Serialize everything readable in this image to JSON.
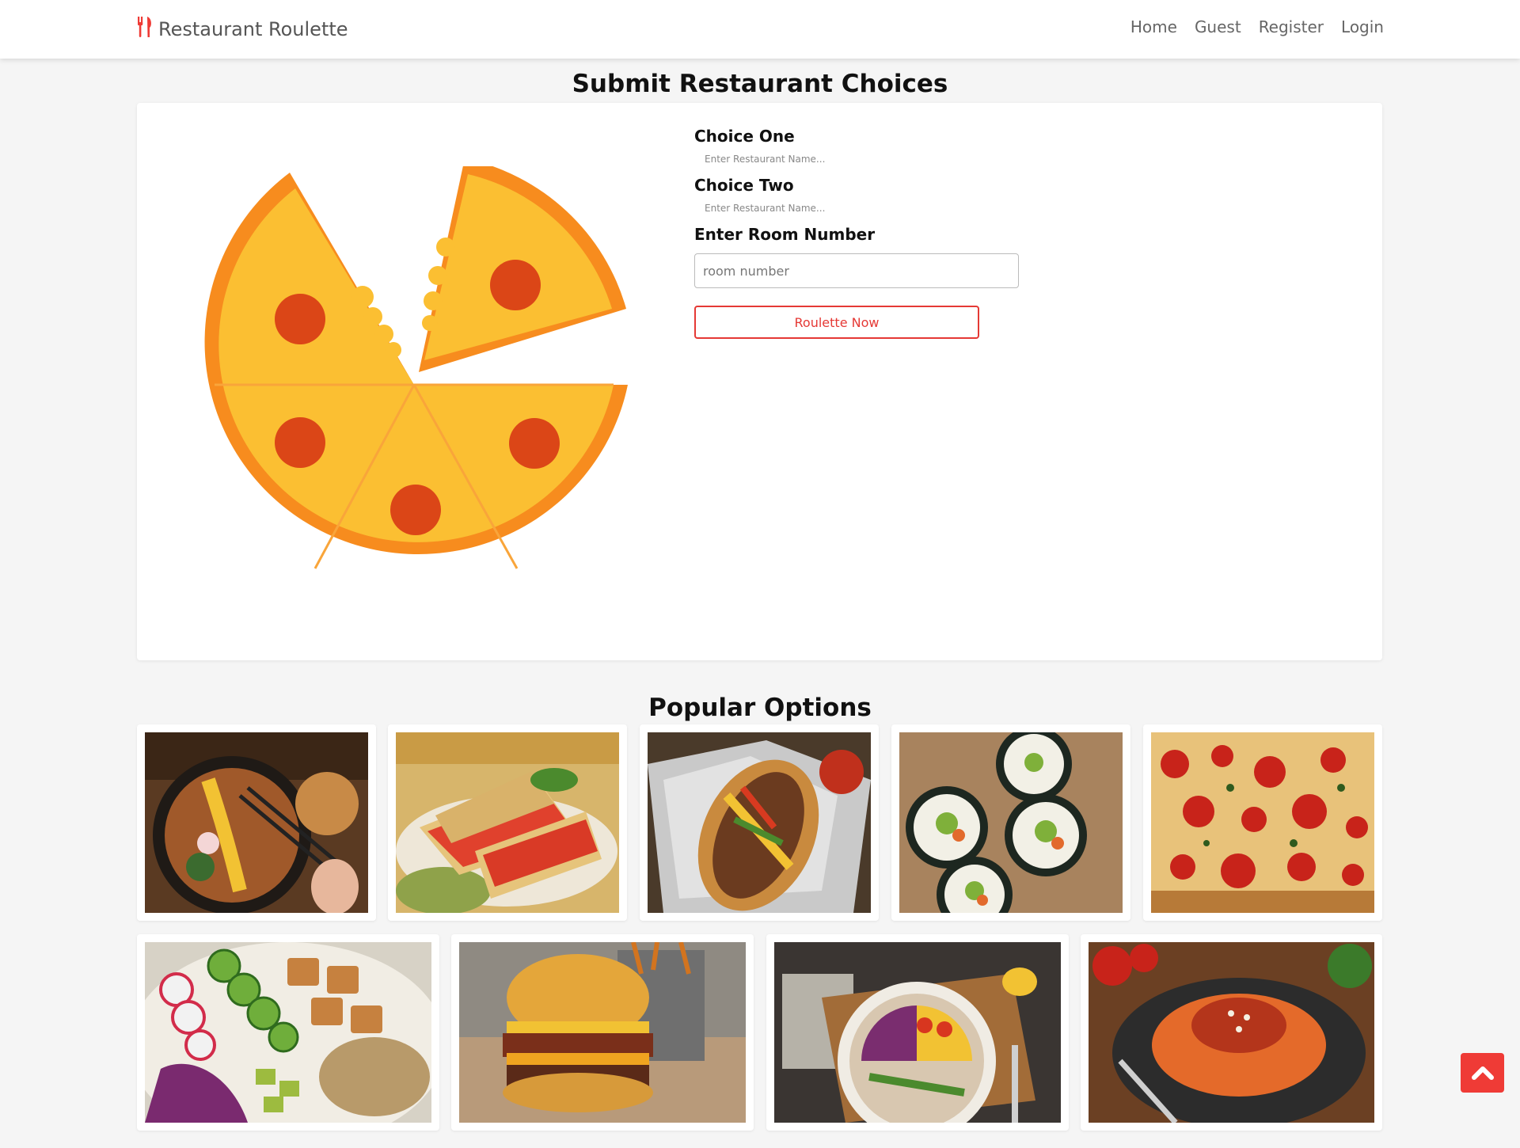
{
  "navbar": {
    "brand": "Restaurant Roulette",
    "links": [
      "Home",
      "Guest",
      "Register",
      "Login"
    ]
  },
  "submit_section": {
    "title": "Submit Restaurant Choices",
    "choice_one_label": "Choice One",
    "choice_one_placeholder": "Enter Restaurant Name...",
    "choice_two_label": "Choice Two",
    "choice_two_placeholder": "Enter Restaurant Name...",
    "room_label": "Enter Room Number",
    "room_placeholder": "room number",
    "submit_label": "Roulette Now"
  },
  "popular": {
    "title": "Popular Options",
    "items": [
      "ramen",
      "panini",
      "cheesesteak",
      "sushi-burrito",
      "pizza",
      "poke-bowl",
      "burger",
      "salad-bowl",
      "spaghetti"
    ]
  },
  "colors": {
    "accent": "#e53935",
    "pizza_crust": "#f78c1e",
    "pizza_cheese": "#fbbf32",
    "pepperoni": "#db4617"
  },
  "icons": {
    "brand": "utensils-icon",
    "scroll_top": "chevron-up-icon"
  }
}
